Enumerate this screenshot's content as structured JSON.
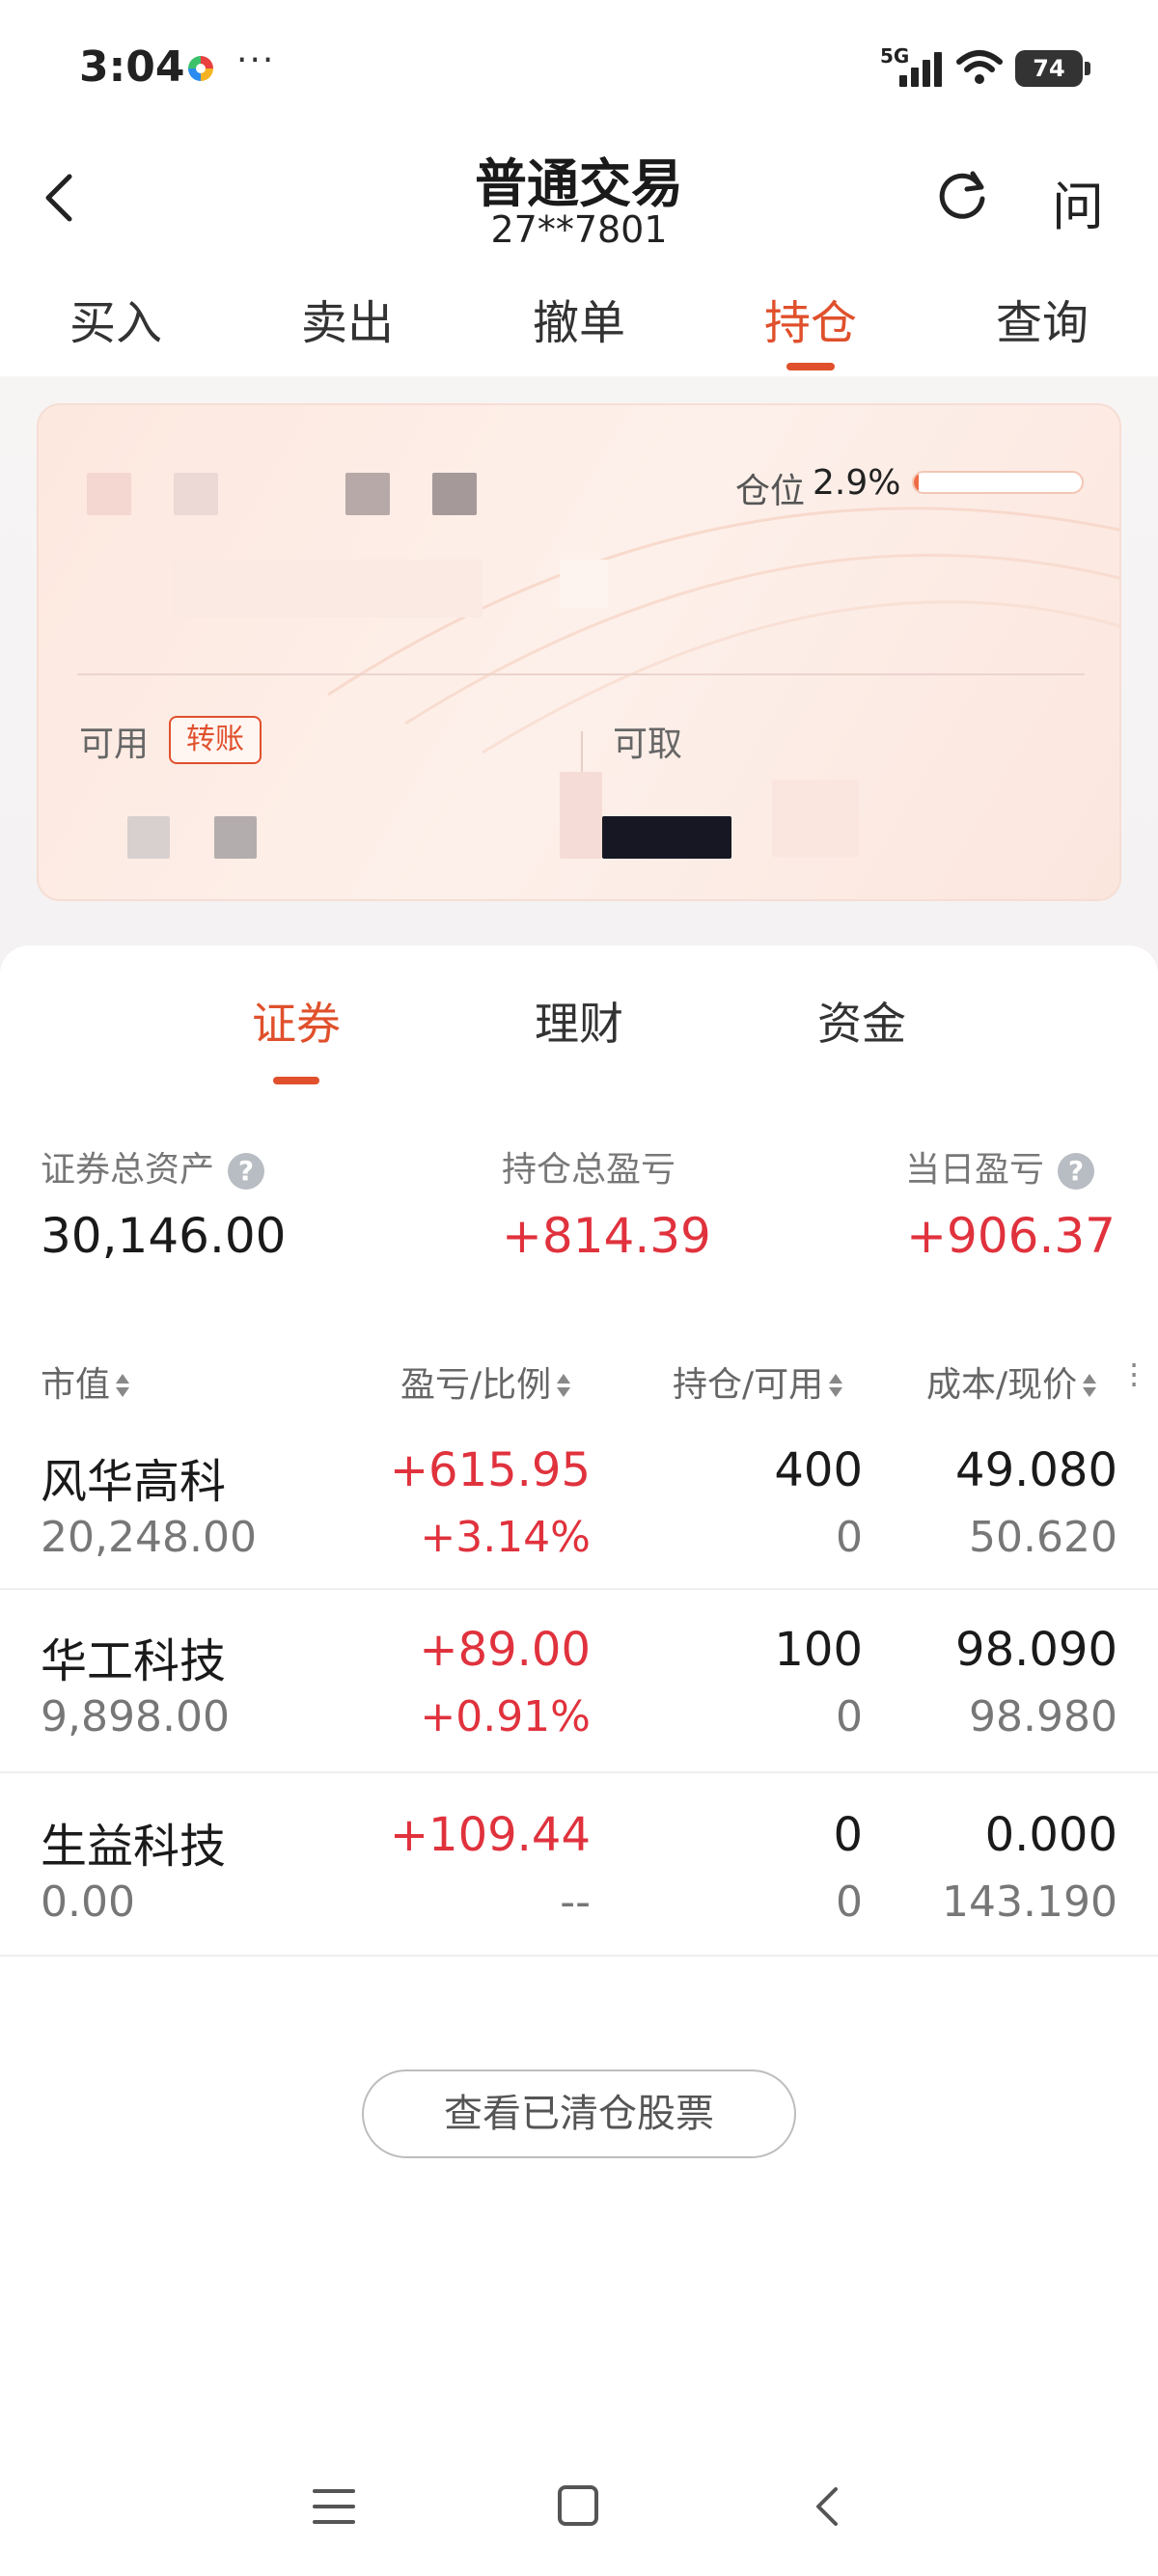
{
  "status_bar": {
    "time": "3:04",
    "dots": "···",
    "network": "5G",
    "battery": "74"
  },
  "header": {
    "title": "普通交易",
    "account": "27**7801",
    "help_label": "问"
  },
  "main_tabs": [
    {
      "label": "买入"
    },
    {
      "label": "卖出"
    },
    {
      "label": "撤单"
    },
    {
      "label": "持仓"
    },
    {
      "label": "查询"
    }
  ],
  "card": {
    "position_label": "仓位",
    "position_value": "2.9%",
    "position_ratio": 0.029,
    "available_label": "可用",
    "transfer_label": "转账",
    "withdrawable_label": "可取"
  },
  "sub_tabs": [
    {
      "label": "证券"
    },
    {
      "label": "理财"
    },
    {
      "label": "资金"
    }
  ],
  "summary": {
    "total_assets_label": "证券总资产",
    "total_assets_value": "30,146.00",
    "holding_pl_label": "持仓总盈亏",
    "holding_pl_value": "+814.39",
    "daily_pl_label": "当日盈亏",
    "daily_pl_value": "+906.37",
    "help_glyph": "?"
  },
  "table": {
    "headers": [
      "市值",
      "盈亏/比例",
      "持仓/可用",
      "成本/现价"
    ],
    "rows": [
      {
        "name": "风华高科",
        "market_value": "20,248.00",
        "pl": "+615.95",
        "pl_ratio": "+3.14%",
        "holding": "400",
        "available": "0",
        "cost": "49.080",
        "price": "50.620"
      },
      {
        "name": "华工科技",
        "market_value": "9,898.00",
        "pl": "+89.00",
        "pl_ratio": "+0.91%",
        "holding": "100",
        "available": "0",
        "cost": "98.090",
        "price": "98.980"
      },
      {
        "name": "生益科技",
        "market_value": "0.00",
        "pl": "+109.44",
        "pl_ratio": "--",
        "holding": "0",
        "available": "0",
        "cost": "0.000",
        "price": "143.190"
      }
    ]
  },
  "cleared_button_label": "查看已清仓股票",
  "colors": {
    "accent": "#e0502c",
    "profit": "#e0323d"
  }
}
